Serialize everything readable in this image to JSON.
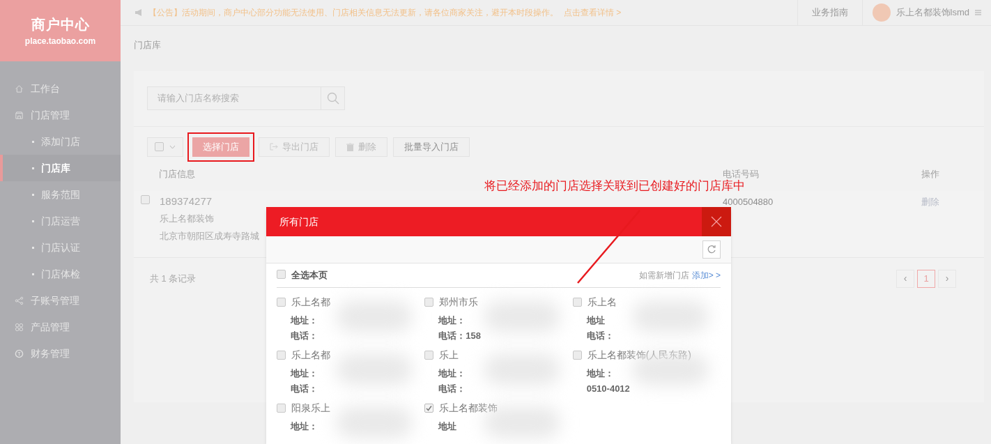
{
  "logo": {
    "title": "商户中心",
    "subtitle": "place.taobao.com"
  },
  "notice": {
    "tag": "【公告】",
    "text": "活动期间，商户中心部分功能无法使用、门店相关信息无法更新，请各位商家关注，避开本时段操作。",
    "link": "点击查看详情 >"
  },
  "header_links": [
    "业务指南"
  ],
  "user": {
    "name": "乐上名都装饰lsmd"
  },
  "breadcrumb": "门店库",
  "sidebar": {
    "items": [
      {
        "label": "工作台",
        "selected": false
      },
      {
        "label": "门店管理",
        "selected": false,
        "children": [
          {
            "label": "添加门店",
            "selected": false
          },
          {
            "label": "门店库",
            "selected": true
          },
          {
            "label": "服务范围",
            "selected": false
          },
          {
            "label": "门店运营",
            "selected": false
          },
          {
            "label": "门店认证",
            "selected": false
          },
          {
            "label": "门店体检",
            "selected": false
          }
        ]
      },
      {
        "label": "子账号管理",
        "selected": false
      },
      {
        "label": "产品管理",
        "selected": false
      },
      {
        "label": "财务管理",
        "selected": false
      }
    ]
  },
  "search": {
    "placeholder": "请输入门店名称搜索"
  },
  "toolbar": {
    "select_all_checked": false,
    "buttons": [
      {
        "label": "选择门店",
        "kind": "primary",
        "disabled": false
      },
      {
        "label": "导出门店",
        "kind": "export",
        "disabled": true
      },
      {
        "label": "删除",
        "kind": "delete",
        "disabled": true
      },
      {
        "label": "批量导入门店",
        "kind": "plain",
        "disabled": false
      }
    ]
  },
  "table": {
    "columns": [
      "门店信息",
      "电话号码",
      "操作"
    ],
    "rows": [
      {
        "checked": false,
        "id": "189374277",
        "name": "乐上名都装饰",
        "address": "北京市朝阳区成寿寺路城",
        "phone": "4000504880",
        "action": "删除"
      }
    ]
  },
  "record_count": "共 1 条记录",
  "pagination": {
    "prev": "‹",
    "pages": [
      {
        "label": "1",
        "selected": true
      }
    ],
    "next": "›"
  },
  "annotation": "将已经添加的门店选择关联到已创建好的门店库中",
  "modal": {
    "title": "所有门店",
    "select_all": {
      "label": "全选本页",
      "checked": false
    },
    "add_hint": "如需新增门店",
    "add_link": "添加> >",
    "stores": [
      {
        "name": "乐上名都",
        "address": "地址：",
        "phone": "电话：",
        "checked": false
      },
      {
        "name": "郑州市乐",
        "address": "地址：",
        "phone": "电话：158",
        "checked": false
      },
      {
        "name": "乐上名",
        "address": "地址",
        "phone": "电话：",
        "checked": false
      },
      {
        "name": "乐上名都",
        "address": "地址：",
        "phone": "电话：",
        "checked": false
      },
      {
        "name": "乐上",
        "address": "地址：",
        "phone": "电话：",
        "checked": false
      },
      {
        "name": "乐上名都装饰(人民东路)",
        "address": "地址：",
        "phone": "0510-4012",
        "checked": false
      },
      {
        "name": "阳泉乐上",
        "address": "地址：",
        "checked": false
      },
      {
        "name": "乐上名都装饰",
        "address": "地址",
        "checked": true
      }
    ]
  }
}
